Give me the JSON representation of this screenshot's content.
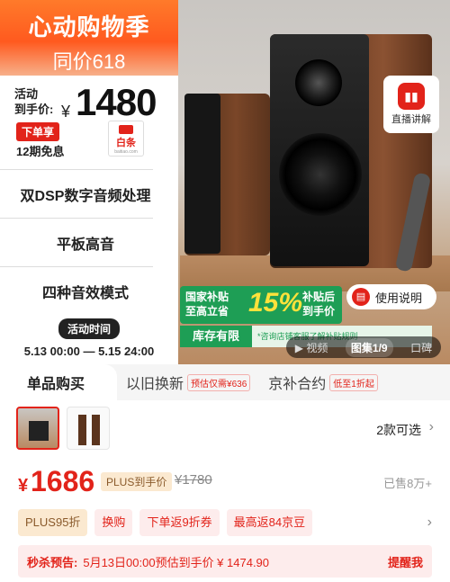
{
  "promo": {
    "title_partial": "",
    "title": "心动购物季",
    "subtitle": "同价618",
    "price_label": "活动\n到手价:",
    "yen": "¥",
    "price": "1480",
    "order_badge": "下单享",
    "installment": "12期免息",
    "baitiao_name": "白条",
    "baitiao_url": "baitiao.com",
    "features": [
      "双DSP数字音频处理",
      "平板高音",
      "四种音效模式"
    ],
    "time_label": "活动时间",
    "time_range": "5.13 00:00 — 5.15 24:00"
  },
  "hero": {
    "live_icon": "bars-icon",
    "live_label": "直播讲解",
    "manual_label": "使用说明",
    "subsidy_left": "国家补贴\n至高立省",
    "subsidy_percent": "15%",
    "subsidy_right": "补贴后\n到手价",
    "stock_label": "库存有限",
    "stock_note": "*咨询店铺客服了解补贴规则",
    "media_tabs": [
      "▶ 视频",
      "图集1/9",
      "口碑"
    ]
  },
  "tabs": [
    {
      "label": "单品购买",
      "tag": ""
    },
    {
      "label": "以旧换新",
      "tag": "预估仅需¥636"
    },
    {
      "label": "京补合约",
      "tag": "低至1折起"
    }
  ],
  "variants": {
    "count_label": "2款可选"
  },
  "price": {
    "yen": "¥",
    "value": "1686",
    "tag": "PLUS到手价",
    "original": "¥1780",
    "sold": "已售8万+"
  },
  "coupons": [
    "PLUS95折",
    "换购",
    "下单返9折券",
    "最高返84京豆"
  ],
  "presale": {
    "label": "秒杀预告:",
    "text": "5月13日00:00预估到手价 ¥ 1474.90",
    "button": "提醒我"
  },
  "colors": {
    "accent": "#e2231a",
    "green": "#1e9e55",
    "orange": "#ff5a1f"
  }
}
